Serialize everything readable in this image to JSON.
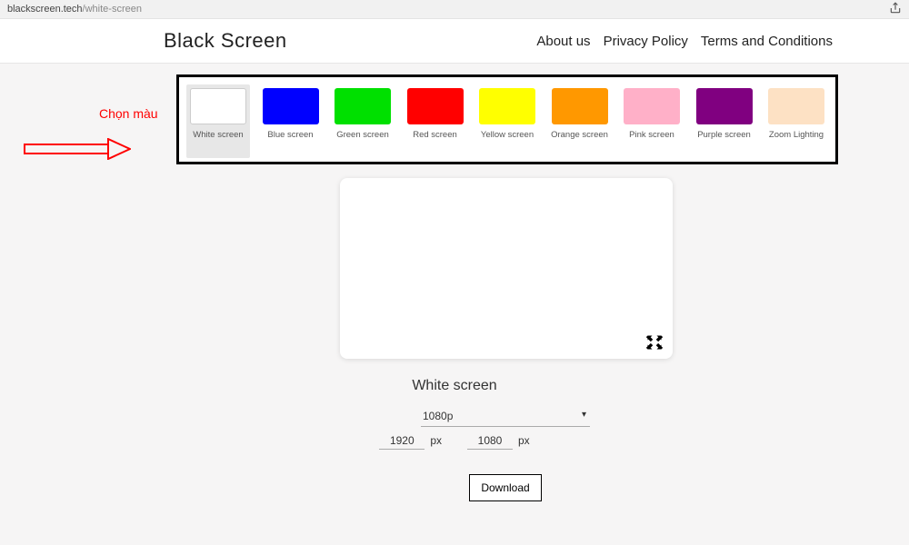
{
  "url": {
    "host": "blackscreen.tech",
    "path": "/white-screen"
  },
  "header": {
    "brand": "Black Screen",
    "nav": [
      "About us",
      "Privacy Policy",
      "Terms and Conditions"
    ]
  },
  "annotation": {
    "label": "Chọn màu"
  },
  "colors": [
    {
      "label": "White screen",
      "color": "#ffffff",
      "selected": true
    },
    {
      "label": "Blue screen",
      "color": "#0000ff"
    },
    {
      "label": "Green screen",
      "color": "#00e000"
    },
    {
      "label": "Red screen",
      "color": "#ff0000"
    },
    {
      "label": "Yellow screen",
      "color": "#ffff00"
    },
    {
      "label": "Orange screen",
      "color": "#ff9800"
    },
    {
      "label": "Pink screen",
      "color": "#ffb0c8"
    },
    {
      "label": "Purple screen",
      "color": "#800080"
    },
    {
      "label": "Zoom Lighting",
      "color": "#fde1c4"
    }
  ],
  "preview": {
    "title": "White screen",
    "bg": "#ffffff"
  },
  "resolution": {
    "selected": "1080p",
    "width": "1920",
    "height": "1080",
    "unit": "px"
  },
  "download_label": "Download"
}
